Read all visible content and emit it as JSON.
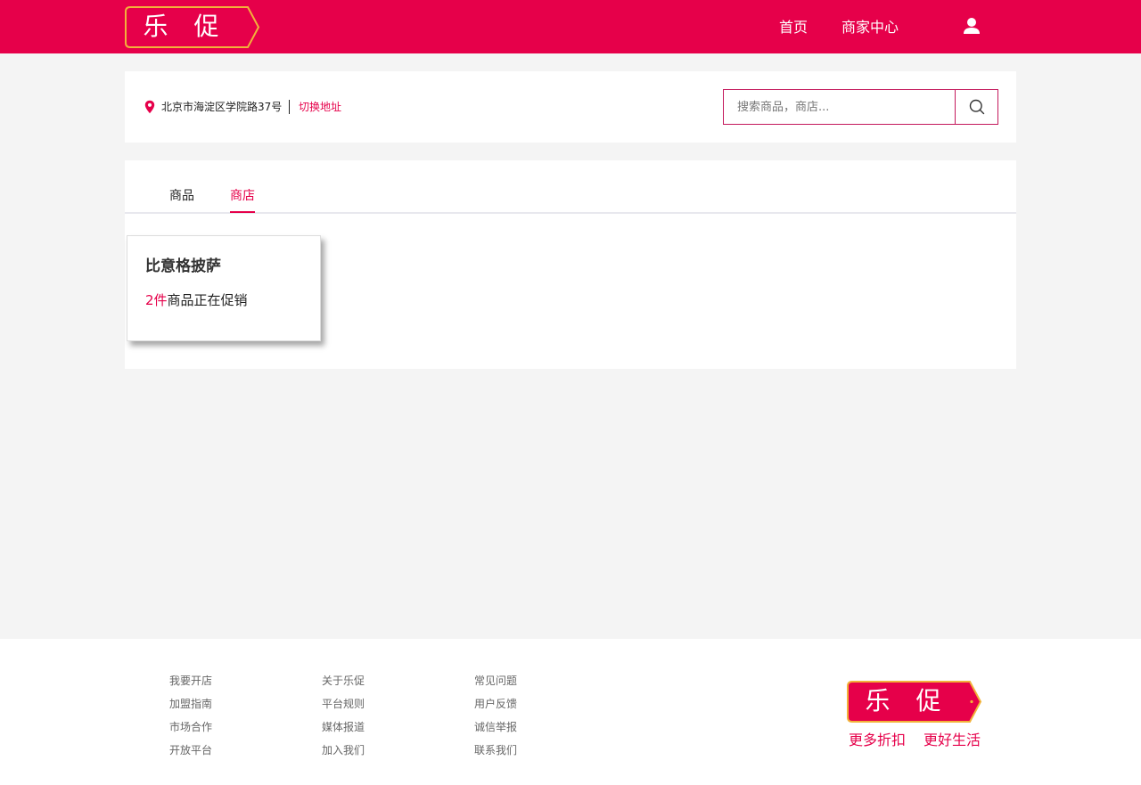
{
  "colors": {
    "brand": "#e6004a",
    "logo_border": "#f2b23a",
    "page_bg": "#f4f4f4"
  },
  "header": {
    "logo_text": "乐 促",
    "nav": {
      "home": "首页",
      "merchant_center": "商家中心"
    },
    "user_icon": "user-icon"
  },
  "location": {
    "address": "北京市海淀区学院路37号",
    "switch_label": "切换地址",
    "icon": "map-pin-icon"
  },
  "search": {
    "placeholder": "搜索商品，商店...",
    "value": "",
    "icon": "search-icon"
  },
  "tabs": {
    "goods": "商品",
    "shops": "商店",
    "active": "shops"
  },
  "results": [
    {
      "name": "比意格披萨",
      "promo_count": "2件",
      "promo_text": "商品正在促销"
    }
  ],
  "footer": {
    "columns": [
      [
        "我要开店",
        "加盟指南",
        "市场合作",
        "开放平台"
      ],
      [
        "关于乐促",
        "平台规则",
        "媒体报道",
        "加入我们"
      ],
      [
        "常见问题",
        "用户反馈",
        "诚信举报",
        "联系我们"
      ]
    ],
    "logo_text": "乐 促",
    "slogan_1": "更多折扣",
    "slogan_2": "更好生活"
  }
}
